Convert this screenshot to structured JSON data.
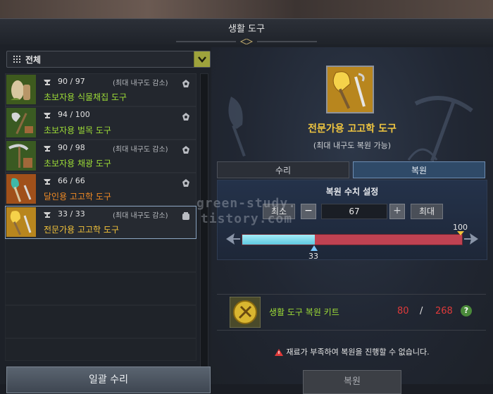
{
  "window": {
    "title": "생활 도구"
  },
  "filter": {
    "label": "전체"
  },
  "tools": [
    {
      "durability": "90 / 97",
      "note": "(최대 내구도 감소)",
      "name": "초보자용 식물채집 도구",
      "color": "#9ddc37",
      "icon": "herbalism-tool-icon"
    },
    {
      "durability": "94 / 100",
      "note": "",
      "name": "초보자용 벌목 도구",
      "color": "#9ddc37",
      "icon": "logging-axe-icon"
    },
    {
      "durability": "90 / 98",
      "note": "(최대 내구도 감소)",
      "name": "초보자용 채광 도구",
      "color": "#9ddc37",
      "icon": "mining-pickaxe-icon"
    },
    {
      "durability": "66 / 66",
      "note": "",
      "name": "달인용 고고학 도구",
      "color": "#f08a24",
      "icon": "archaeology-shovel-icon"
    },
    {
      "durability": "33 / 33",
      "note": "(최대 내구도 감소)",
      "name": "전문가용 고고학 도구",
      "color": "#f2c23a",
      "icon": "archaeology-shovel-gold-icon"
    }
  ],
  "batch_repair_label": "일괄 수리",
  "detail": {
    "name": "전문가용 고고학 도구",
    "subtitle": "(최대 내구도 복원 가능)",
    "tab_repair": "수리",
    "tab_restore": "복원"
  },
  "restore": {
    "heading": "복원 수치 설정",
    "min_label": "최소",
    "max_label": "최대",
    "minus": "−",
    "plus": "+",
    "value": "67",
    "slider_current": 33,
    "slider_max": 100,
    "slider_current_label": "33",
    "slider_max_label": "100"
  },
  "material": {
    "name": "생활 도구 복원 키트",
    "have": "80",
    "slash": "/",
    "need": "268",
    "help": "?"
  },
  "warning": "재료가 부족하여 복원을 진행할 수 없습니다.",
  "restore_button": "복원",
  "watermark": {
    "line1": "green-study.",
    "line2": "tistory.com"
  }
}
